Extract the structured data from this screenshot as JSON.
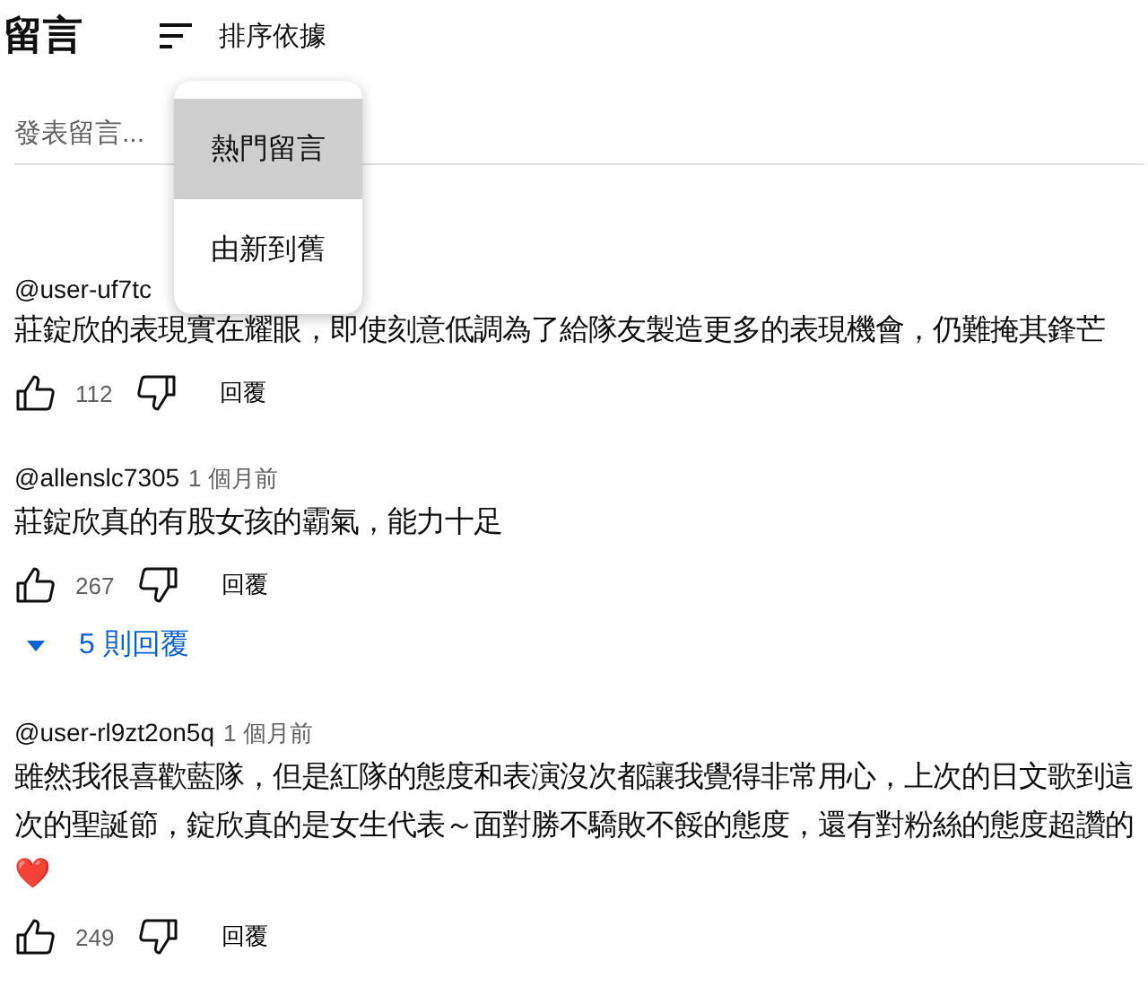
{
  "header": {
    "title": "留言",
    "sort_label": "排序依據"
  },
  "sort_menu": {
    "items": [
      {
        "label": "熱門留言",
        "selected": true
      },
      {
        "label": "由新到舊",
        "selected": false
      }
    ]
  },
  "comment_field": {
    "placeholder": "發表留言..."
  },
  "comments": [
    {
      "author": "@user-uf7tc",
      "text": "莊錠欣的表現實在耀眼，即使刻意低調為了給隊友製造更多的表現機會，仍難掩其鋒芒",
      "likes": "112",
      "reply_label": "回覆"
    },
    {
      "author": "@allenslc7305",
      "time": "1 個月前",
      "text": "莊錠欣真的有股女孩的霸氣，能力十足",
      "likes": "267",
      "reply_label": "回覆",
      "replies": "5 則回覆"
    },
    {
      "author": "@user-rl9zt2on5q",
      "time": "1 個月前",
      "text": "雖然我很喜歡藍隊，但是紅隊的態度和表演沒次都讓我覺得非常用心，上次的日文歌到這次的聖誕節，錠欣真的是女生代表～面對勝不驕敗不餒的態度，還有對粉絲的態度超讚的 ❤️",
      "likes": "249",
      "reply_label": "回覆"
    }
  ]
}
